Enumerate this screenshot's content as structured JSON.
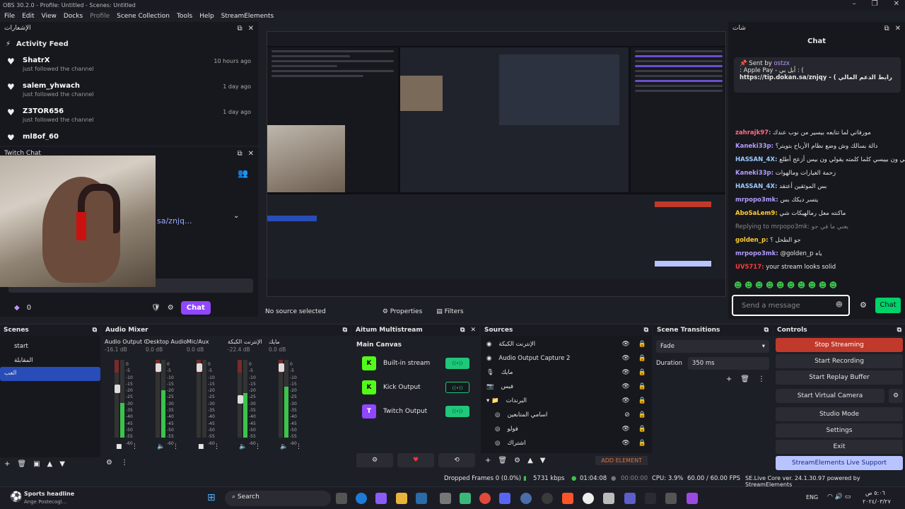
{
  "window": {
    "title": "OBS 30.2.0 - Profile: Untitled - Scenes: Untitled"
  },
  "menu": [
    "File",
    "Edit",
    "View",
    "Docks",
    "Profile",
    "Scene Collection",
    "Tools",
    "Help",
    "StreamElements"
  ],
  "activity": {
    "dock_title": "الإشعارات",
    "title": "Activity Feed",
    "items": [
      {
        "name": "ShatrX",
        "sub": "just followed the channel",
        "time": "10 hours ago"
      },
      {
        "name": "salem_yhwach",
        "sub": "just followed the channel",
        "time": "1 day ago"
      },
      {
        "name": "Z3TOR656",
        "sub": "just followed the channel",
        "time": "1 day ago"
      },
      {
        "name": "ml8of_60",
        "sub": "",
        "time": ""
      }
    ]
  },
  "twitch": {
    "dock_title": "Twitch Chat",
    "url": "sa/znjq...",
    "points": "0",
    "chat_label": "Chat"
  },
  "chat": {
    "dock_title": "شات",
    "title": "Chat",
    "pinned_by": "Sent by",
    "pinned_user": "ostzx",
    "pinned_line1": ": Apple Pay - أبل بي : (",
    "pinned_line2": "https://tip.dokan.sa/znjqy - ( رابط الدعم المالي",
    "messages": [
      {
        "user": "zahrajk97:",
        "text": "مورفاتي لما تتابعه بيسير من نوب عندك",
        "color": "#ff6b8a"
      },
      {
        "user": "Kaneki33p:",
        "text": "دالة بسالك وش وضع نظام الأرباح بتويتر؟",
        "color": "#b19cff"
      },
      {
        "user": "HASSAN_4X:",
        "text": "خويي ون بييسي كلما كلمته يقولي ون بيس أزعج أطلع",
        "color": "#9ecbff"
      },
      {
        "user": "Kaneki33p:",
        "text": "زحمة الغيارات ومالهوات",
        "color": "#b19cff"
      },
      {
        "user": "HASSAN_4X:",
        "text": "بس الموثقين أعتقد",
        "color": "#9ecbff"
      },
      {
        "user": "mrpopo3mk:",
        "text": "يتسر ديكك بس",
        "color": "#b19cff"
      },
      {
        "user": "AboSaLem9:",
        "text": "ماكنته معل رمالهيكات شي",
        "color": "#ffcc33"
      },
      {
        "user": "golden_p:",
        "text": "جو الطحل ؟",
        "color": "#ffcc33"
      },
      {
        "user": "mrpopo3mk:",
        "text": "@golden_p ياه",
        "color": "#b19cff"
      },
      {
        "user": "UV5717:",
        "text": "your stream looks solid",
        "color": "#ff3b3b"
      }
    ],
    "reply_note": "Replying to mrpopo3mk: يعني ما في جو",
    "send_placeholder": "Send a message",
    "send_button": "Chat"
  },
  "preview": {
    "no_source": "No source selected",
    "properties": "Properties",
    "filters": "Filters"
  },
  "scenes": {
    "title": "Scenes",
    "items": [
      "start",
      "المقابلة",
      "العب"
    ],
    "selected": 2
  },
  "mixer": {
    "title": "Audio Mixer",
    "channels": [
      {
        "name": "Audio Output Ca",
        "db": "-16.1 dB",
        "level": 0.55,
        "knob": 0.65
      },
      {
        "name": "Desktop Audio",
        "db": "0.0 dB",
        "level": 0.75,
        "knob": 0.95
      },
      {
        "name": "Mic/Aux",
        "db": "0.0 dB",
        "level": 0,
        "knob": 0.95
      },
      {
        "name": "الإنترنت الكبكة",
        "db": "-22.4 dB",
        "level": 0.7,
        "knob": 0.5
      },
      {
        "name": "مايك",
        "db": "0.0 dB",
        "level": 0.8,
        "knob": 0.95
      }
    ],
    "ticks": [
      "0",
      "-5",
      "-10",
      "-15",
      "-20",
      "-25",
      "-30",
      "-35",
      "-40",
      "-45",
      "-50",
      "-55",
      "-60"
    ]
  },
  "aitum": {
    "title": "Aitum Multistream",
    "section": "Main Canvas",
    "outputs": [
      {
        "name": "Built-in stream",
        "icon": "K",
        "on": true
      },
      {
        "name": "Kick Output",
        "icon": "K",
        "on": false
      },
      {
        "name": "Twitch Output",
        "icon": "T",
        "on": true
      }
    ]
  },
  "sources": {
    "title": "Sources",
    "items": [
      "الإنترنت الكبكة",
      "Audio Output Capture 2",
      "مايك",
      "فيس",
      "البرندات",
      "اسامي المتابعين",
      "فولو",
      "اشتراك"
    ],
    "add_element": "ADD ELEMENT"
  },
  "transitions": {
    "title": "Scene Transitions",
    "selected": "Fade",
    "duration_label": "Duration",
    "duration": "350 ms"
  },
  "controls": {
    "title": "Controls",
    "buttons": [
      "Stop Streaming",
      "Start Recording",
      "Start Replay Buffer",
      "Start Virtual Camera",
      "Studio Mode",
      "Settings",
      "Exit",
      "StreamElements Live Support"
    ]
  },
  "status": {
    "dropped": "Dropped Frames 0 (0.0%)",
    "kbps": "5731 kbps",
    "live_time": "01:04:08",
    "rec_time": "00:00:00",
    "cpu": "CPU: 3.9%",
    "fps": "60.00 / 60.00 FPS",
    "se": "SE.Live Core ver. 24.1.30.97 powered by StreamElements"
  },
  "taskbar": {
    "news_title": "Sports headline",
    "news_sub": "Ange Postecogl...",
    "search": "Search",
    "lang": "ENG",
    "time": "٥:٠٦ ص",
    "date": "٢٠٢٤/٠٣/٢٧"
  }
}
